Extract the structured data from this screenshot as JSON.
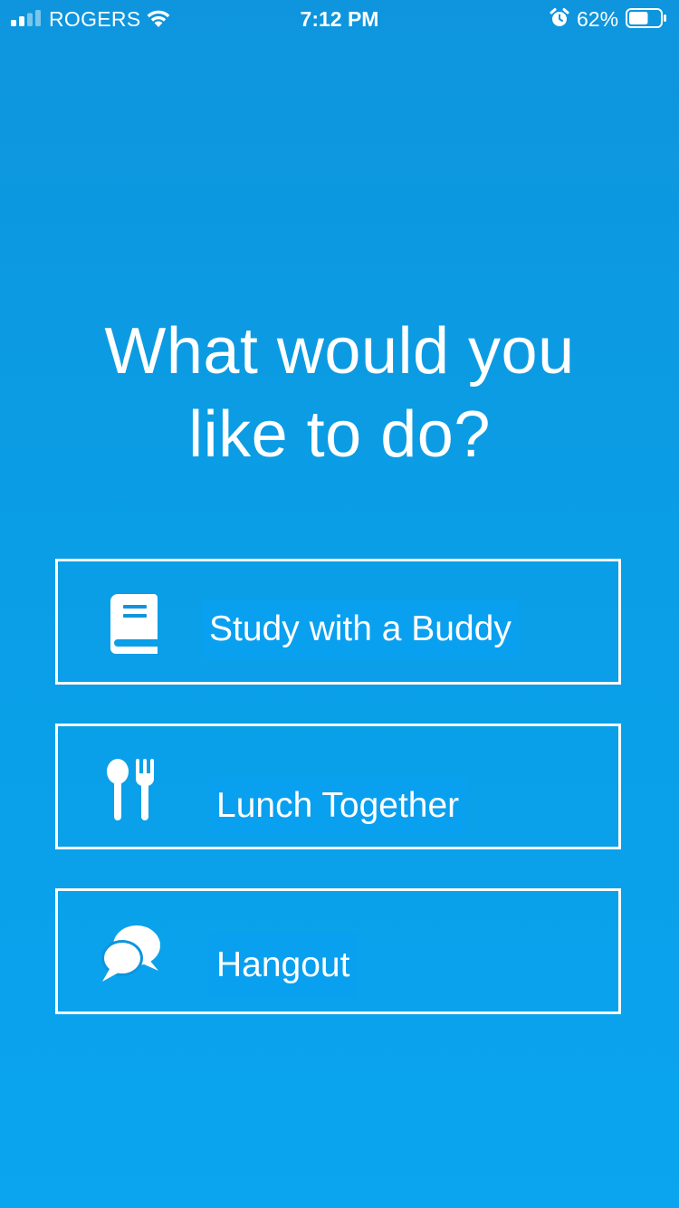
{
  "status_bar": {
    "carrier": "ROGERS",
    "time": "7:12 PM",
    "battery_percent": "62%",
    "battery_level": 0.62,
    "signal_bars_filled": 2,
    "signal_bars_total": 4,
    "icons": [
      "signal-icon",
      "wifi-icon",
      "alarm-icon",
      "battery-icon"
    ]
  },
  "heading": {
    "line1": "What would you",
    "line2": "like to do?"
  },
  "options": [
    {
      "label": "Study with  a Buddy",
      "icon": "book-icon"
    },
    {
      "label": "Lunch Together",
      "icon": "utensils-icon"
    },
    {
      "label": "Hangout",
      "icon": "chat-bubbles-icon"
    }
  ],
  "colors": {
    "background_top": "#0e95dd",
    "background_bottom": "#0aa4ef",
    "foreground": "#ffffff"
  }
}
